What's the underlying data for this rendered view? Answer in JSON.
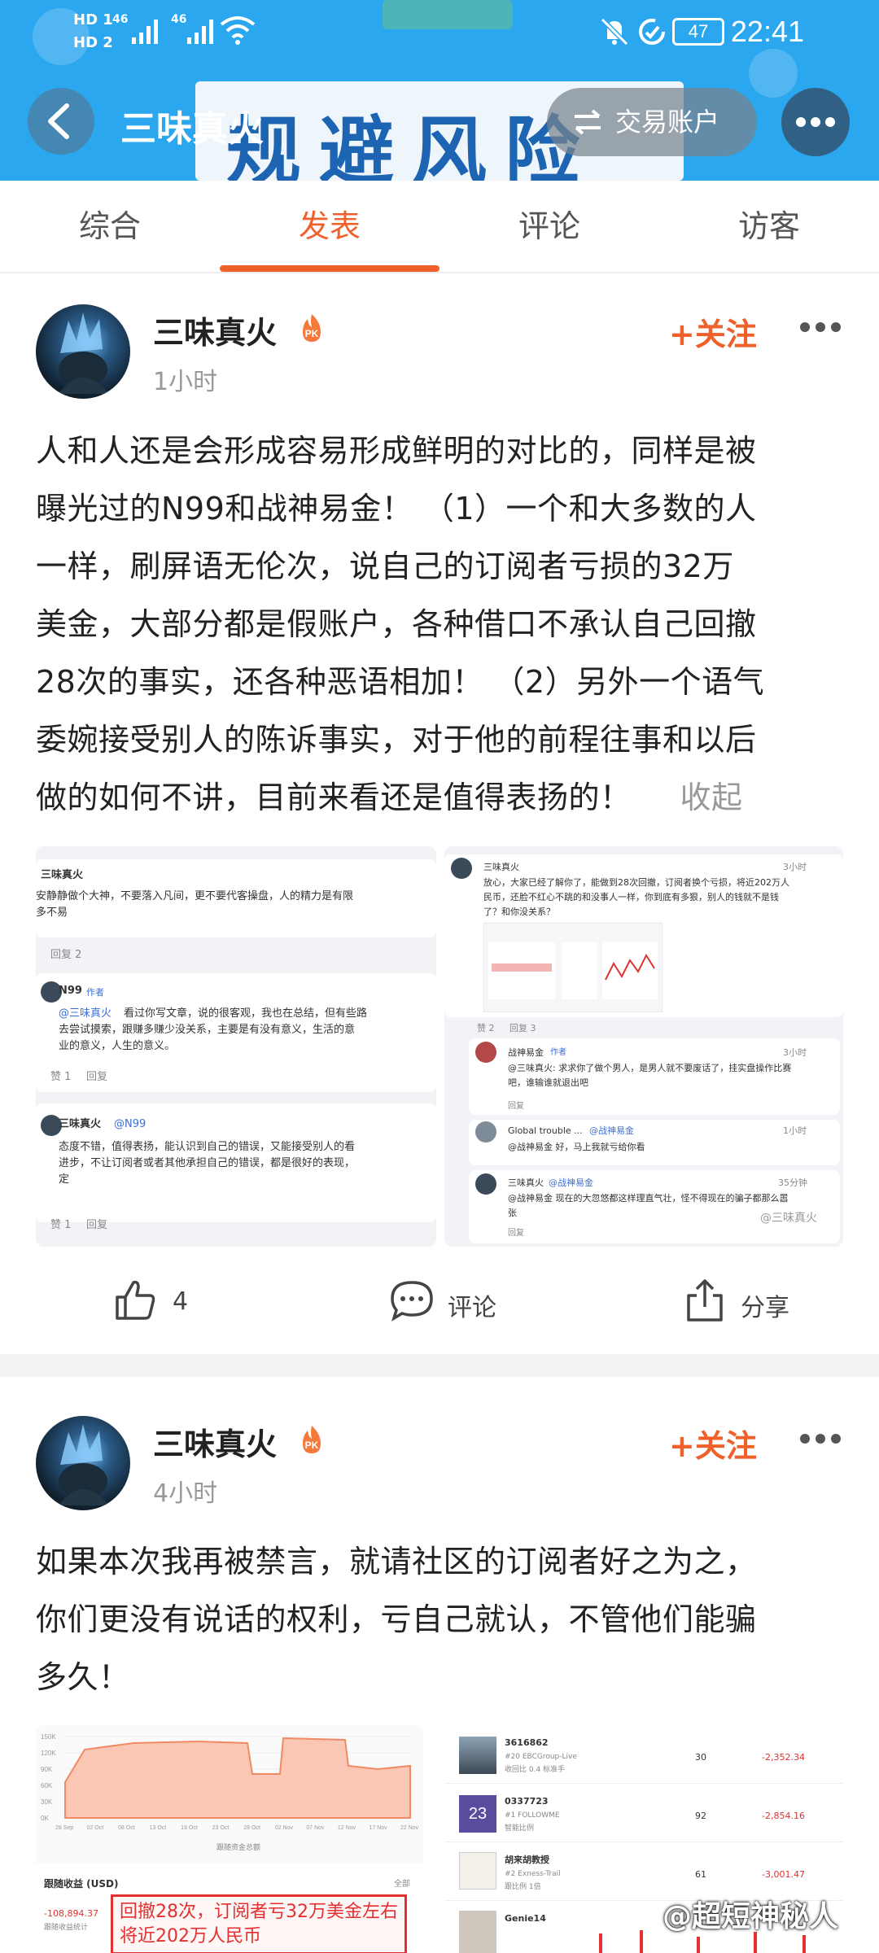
{
  "status_bar": {
    "network_top": "HD 1",
    "network_bottom": "HD 2",
    "signal_1": "46",
    "signal_2": "46",
    "battery": "47",
    "time": "22:41"
  },
  "header": {
    "title": "三味真火",
    "banner_text": "规避风险",
    "account_label": "交易账户",
    "colors": {
      "header_bg": "#2ba7ef",
      "banner_text": "#1d64b3"
    }
  },
  "tabs": [
    {
      "label": "综合"
    },
    {
      "label": "发表"
    },
    {
      "label": "评论"
    },
    {
      "label": "访客"
    }
  ],
  "active_tab": "发表",
  "accent_color": "#f0602a",
  "posts": [
    {
      "author": "三味真火",
      "badge": "PK",
      "time": "1小时",
      "follow_label": "+关注",
      "lines": [
        "人和人还是会形成容易形成鲜明的对比的，同样是被",
        "曝光过的N99和战神易金！ （1）一个和大多数的人",
        "一样，刷屏语无伦次，说自己的订阅者亏损的32万",
        "美金，大部分都是假账户，各种借口不承认自己回撤",
        "28次的事实，还各种恶语相加！ （2）另外一个语气",
        "委婉接受别人的陈诉事实，对于他的前程往事和以后",
        "做的如何不讲，目前来看还是值得表扬的！"
      ],
      "collapse_label": "收起",
      "left_image": {
        "c1_author": "三味真火",
        "c1_text_1": "安静静做个大神，不要落入凡间，更不要代客操盘，人的精力是有限",
        "c1_text_2": "多不易",
        "c1_replies": "回复 2",
        "c2_author": "N99",
        "c2_tag": "作者",
        "c2_mention": "@三味真火",
        "c2_text_1": "看过你写文章，说的很客观，我也在总结，但有些路",
        "c2_text_2": "去尝试摸索，跟赚多赚少没关系，主要是有没有意义，生活的意",
        "c2_text_3": "业的意义，人生的意义。",
        "c2_like": "赞 1",
        "c2_reply": "回复",
        "c3_author": "三味真火",
        "c3_mention": "@N99",
        "c3_text_1": "态度不错，值得表扬，能认识到自己的错误，又能接受别人的看",
        "c3_text_2": "进步，不让订阅者或者其他承担自己的错误，都是很好的表现，",
        "c3_text_3": "定",
        "c3_like": "赞 1",
        "c3_reply": "回复"
      },
      "right_image": {
        "c1_author": "三味真火",
        "c1_time": "3小时",
        "c1_text_1": "放心，大家已经了解你了，能做到28次回撤，订阅者换个亏损，将近202万人",
        "c1_text_2": "民币，还脸不红心不跳的和没事人一样，你到底有多狠，别人的钱就不是钱",
        "c1_text_3": "了？和你没关系？",
        "c1_like": "赞 2",
        "c1_replies": "回复 3",
        "c2_author": "战神易金",
        "c2_tag": "作者",
        "c2_time": "3小时",
        "c2_text_1": "@三味真火: 求求你了做个男人，是男人就不要废话了，挂实盘操作比赛",
        "c2_text_2": "吧，谁输谁就退出吧",
        "c2_reply": "回复",
        "c3_author": "Global trouble ...",
        "c3_mention": "@战神易金",
        "c3_time": "1小时",
        "c3_text": "@战神易金 好，马上我就亏给你看",
        "c3_reply": "回复",
        "c4_author": "三味真火",
        "c4_mention": "@战神易金",
        "c4_time": "35分钟",
        "c4_text_1": "@战神易金 现在的大忽悠都这样理直气壮，怪不得现在的骗子都那么嚣",
        "c4_text_2": "张",
        "c4_reply": "回复",
        "watermark": "@三味真火"
      },
      "actions": {
        "likes": "4",
        "comment": "评论",
        "share": "分享"
      }
    },
    {
      "author": "三味真火",
      "badge": "PK",
      "time": "4小时",
      "follow_label": "+关注",
      "lines": [
        "如果本次我再被禁言，就请社区的订阅者好之为之，",
        "你们更没有说话的权利，亏自己就认，不管他们能骗",
        "多久！"
      ],
      "left_image": {
        "y_ticks": [
          "150K",
          "120K",
          "90K",
          "60K",
          "30K",
          "0K"
        ],
        "x_ticks": [
          "28 Sep",
          "02 Oct",
          "08 Oct",
          "13 Oct",
          "18 Oct",
          "23 Oct",
          "28 Oct",
          "02 Nov",
          "07 Nov",
          "12 Nov",
          "17 Nov",
          "22 Nov"
        ],
        "legend": "跟随资金总额",
        "earnings_title": "跟随收益 (USD)",
        "filter": "全部",
        "amount": "-108,894.37",
        "amount_label": "跟随收益统计",
        "annotation_1": "回撤28次，订阅者亏32万美金左右",
        "annotation_2": "将近202万人民币"
      },
      "right_image": {
        "rows": [
          {
            "id": "3616862",
            "rank": "#20",
            "org": "EBCGroup-Live",
            "sub": "收回比 0.4 标准手",
            "count": "30",
            "amount": "-2,352.34"
          },
          {
            "id": "0337723",
            "rank": "#1",
            "org": "FOLLOWME",
            "sub": "智能比例",
            "count": "92",
            "amount": "-2,854.16",
            "badge_num": "23"
          },
          {
            "id": "胡来胡教授",
            "rank": "#2",
            "org": "Exness-Trail",
            "sub": "跟比例 1倍",
            "count": "61",
            "amount": "-3,001.47"
          },
          {
            "id": "Genie14",
            "rank": "",
            "org": "",
            "sub": "",
            "count": "",
            "amount": ""
          }
        ]
      }
    }
  ],
  "bottom_watermark": "@超短神秘人"
}
